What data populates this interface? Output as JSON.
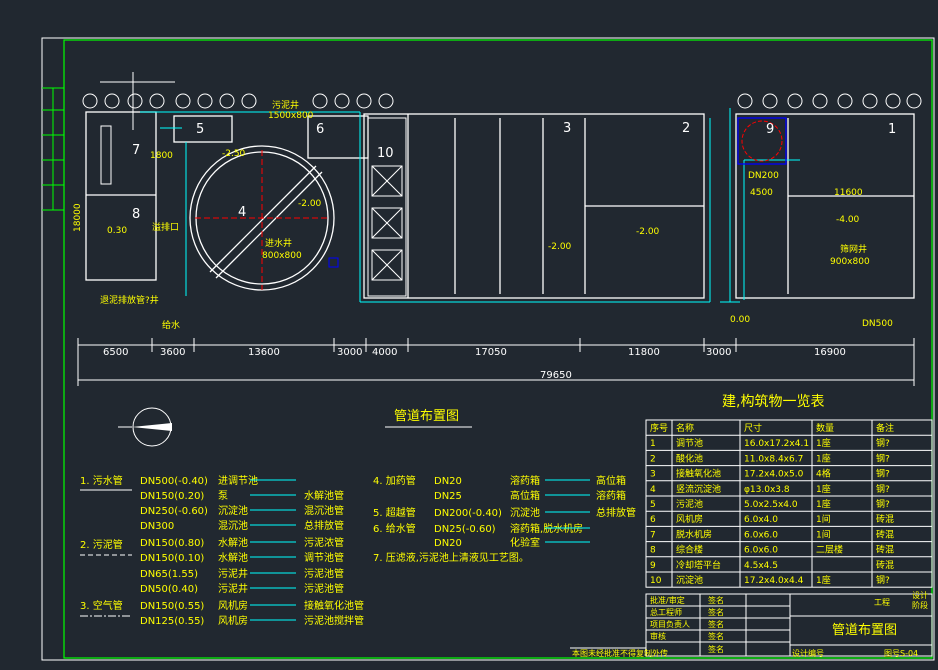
{
  "colors": {
    "background": "#212830",
    "frame_green": "#00ff00",
    "line_white": "#ffffff",
    "line_cyan": "#00ffff",
    "text_yellow": "#ffff00",
    "marker_red": "#ff0000",
    "marker_blue": "#0000ff",
    "marker_magenta": "#ff00ff"
  },
  "plan": {
    "numbers": {
      "n1": "1",
      "n2": "2",
      "n3": "3",
      "n4": "4",
      "n5": "5",
      "n6": "6",
      "n7": "7",
      "n8": "8",
      "n9": "9",
      "n10": "10"
    },
    "labels": {
      "sludge_well": "污泥井",
      "sludge_well_size": "1500x800",
      "elev_250": "-2.50",
      "elev_200a": "-2.00",
      "elev_200b": "-2.00",
      "elev_200c": "-2.00",
      "elev_030": "0.30",
      "elev_400": "-4.00",
      "elev_000": "0.00",
      "size_1800": "1800",
      "inlet_well": "进水井",
      "inlet_well_size": "800x800",
      "dn200": "DN200",
      "dim_4500": "4500",
      "dim_11600": "11600",
      "screen_well": "筛网井",
      "screen_well_size": "900x800",
      "dn500": "DN500",
      "overflow": "溢排口",
      "discharge": "退泥排放管?井",
      "water_in": "给水",
      "width_18000": "18000"
    },
    "dimensions": [
      "6500",
      "3600",
      "13600",
      "3000",
      "4000",
      "17050",
      "11800",
      "3000",
      "16900"
    ],
    "total_length": "79650"
  },
  "title": "管道布置图",
  "legend": {
    "g1_label": "1. 污水管",
    "g2_label": "2. 污泥管",
    "g3_label": "3. 空气管",
    "rows": [
      {
        "size": "DN500(-0.40)",
        "from": "进调节池",
        "pipe": ""
      },
      {
        "size": "DN150(0.20)",
        "from": "泵",
        "pipe": "水解池管"
      },
      {
        "size": "DN250(-0.60)",
        "from": "沉淀池",
        "pipe": "混沉池管"
      },
      {
        "size": "DN300",
        "from": "混沉池",
        "pipe": "总排放管"
      },
      {
        "size": "DN150(0.80)",
        "from": "水解池",
        "pipe": "污泥浓管"
      },
      {
        "size": "DN150(0.10)",
        "from": "水解池",
        "pipe": "调节池管"
      },
      {
        "size": "DN65(1.55)",
        "from": "污泥井",
        "pipe": "污泥池管"
      },
      {
        "size": "DN50(0.40)",
        "from": "污泥井",
        "pipe": "污泥池管"
      },
      {
        "size": "DN150(0.55)",
        "from": "风机房",
        "pipe": "接触氧化池管"
      },
      {
        "size": "DN125(0.55)",
        "from": "风机房",
        "pipe": "污泥池搅拌管"
      }
    ],
    "g4_label": "4. 加药管",
    "g5_label": "5. 超越管",
    "g6_label": "6. 给水管",
    "rows2": [
      {
        "size": "DN20",
        "from": "溶药箱",
        "to": "高位箱"
      },
      {
        "size": "DN25",
        "from": "高位箱",
        "to": "溶药箱"
      },
      {
        "size": "DN200(-0.40)",
        "from": "沉淀池",
        "to": "总排放管"
      },
      {
        "size": "DN25(-0.60)",
        "from": "溶药箱,脱水机房",
        "to": ""
      },
      {
        "size": "DN20",
        "from": "化验室",
        "to": ""
      }
    ],
    "note": "7. 压滤液,污泥池上清液见工艺图。"
  },
  "table": {
    "title": "建,构筑物一览表",
    "headers": [
      "序号",
      "名称",
      "尺寸",
      "数量",
      "备注"
    ],
    "rows": [
      [
        "1",
        "调节池",
        "16.0x17.2x4.1",
        "1座",
        "钢?"
      ],
      [
        "2",
        "酸化池",
        "11.0x8.4x6.7",
        "1座",
        "钢?"
      ],
      [
        "3",
        "接触氧化池",
        "17.2x4.0x5.0",
        "4格",
        "钢?"
      ],
      [
        "4",
        "竖流沉淀池",
        "φ13.0x3.8",
        "1座",
        "钢?"
      ],
      [
        "5",
        "污泥池",
        "5.0x2.5x4.0",
        "1座",
        "钢?"
      ],
      [
        "6",
        "风机房",
        "6.0x4.0",
        "1间",
        "砖混"
      ],
      [
        "7",
        "脱水机房",
        "6.0x6.0",
        "1间",
        "砖混"
      ],
      [
        "8",
        "综合楼",
        "6.0x6.0",
        "二层楼",
        "砖混"
      ],
      [
        "9",
        "冷却塔平台",
        "4.5x4.5",
        "",
        "砖混"
      ],
      [
        "10",
        "沉淀池",
        "17.2x4.0x4.4",
        "1座",
        "钢?"
      ]
    ]
  },
  "title_block": {
    "project": "工程",
    "design": "设计",
    "dept": "阶段",
    "roles": [
      "批准/审定",
      "总工程师",
      "项目负责人",
      "审核"
    ],
    "sign": [
      "签名",
      "签名",
      "签名",
      "签名",
      "签名"
    ],
    "drawing_name": "管道布置图",
    "footer_left": "本图未经批准不得复制外传",
    "footer_mid": "设计编号",
    "footer_right": "图号",
    "footer_code": "S-04"
  }
}
